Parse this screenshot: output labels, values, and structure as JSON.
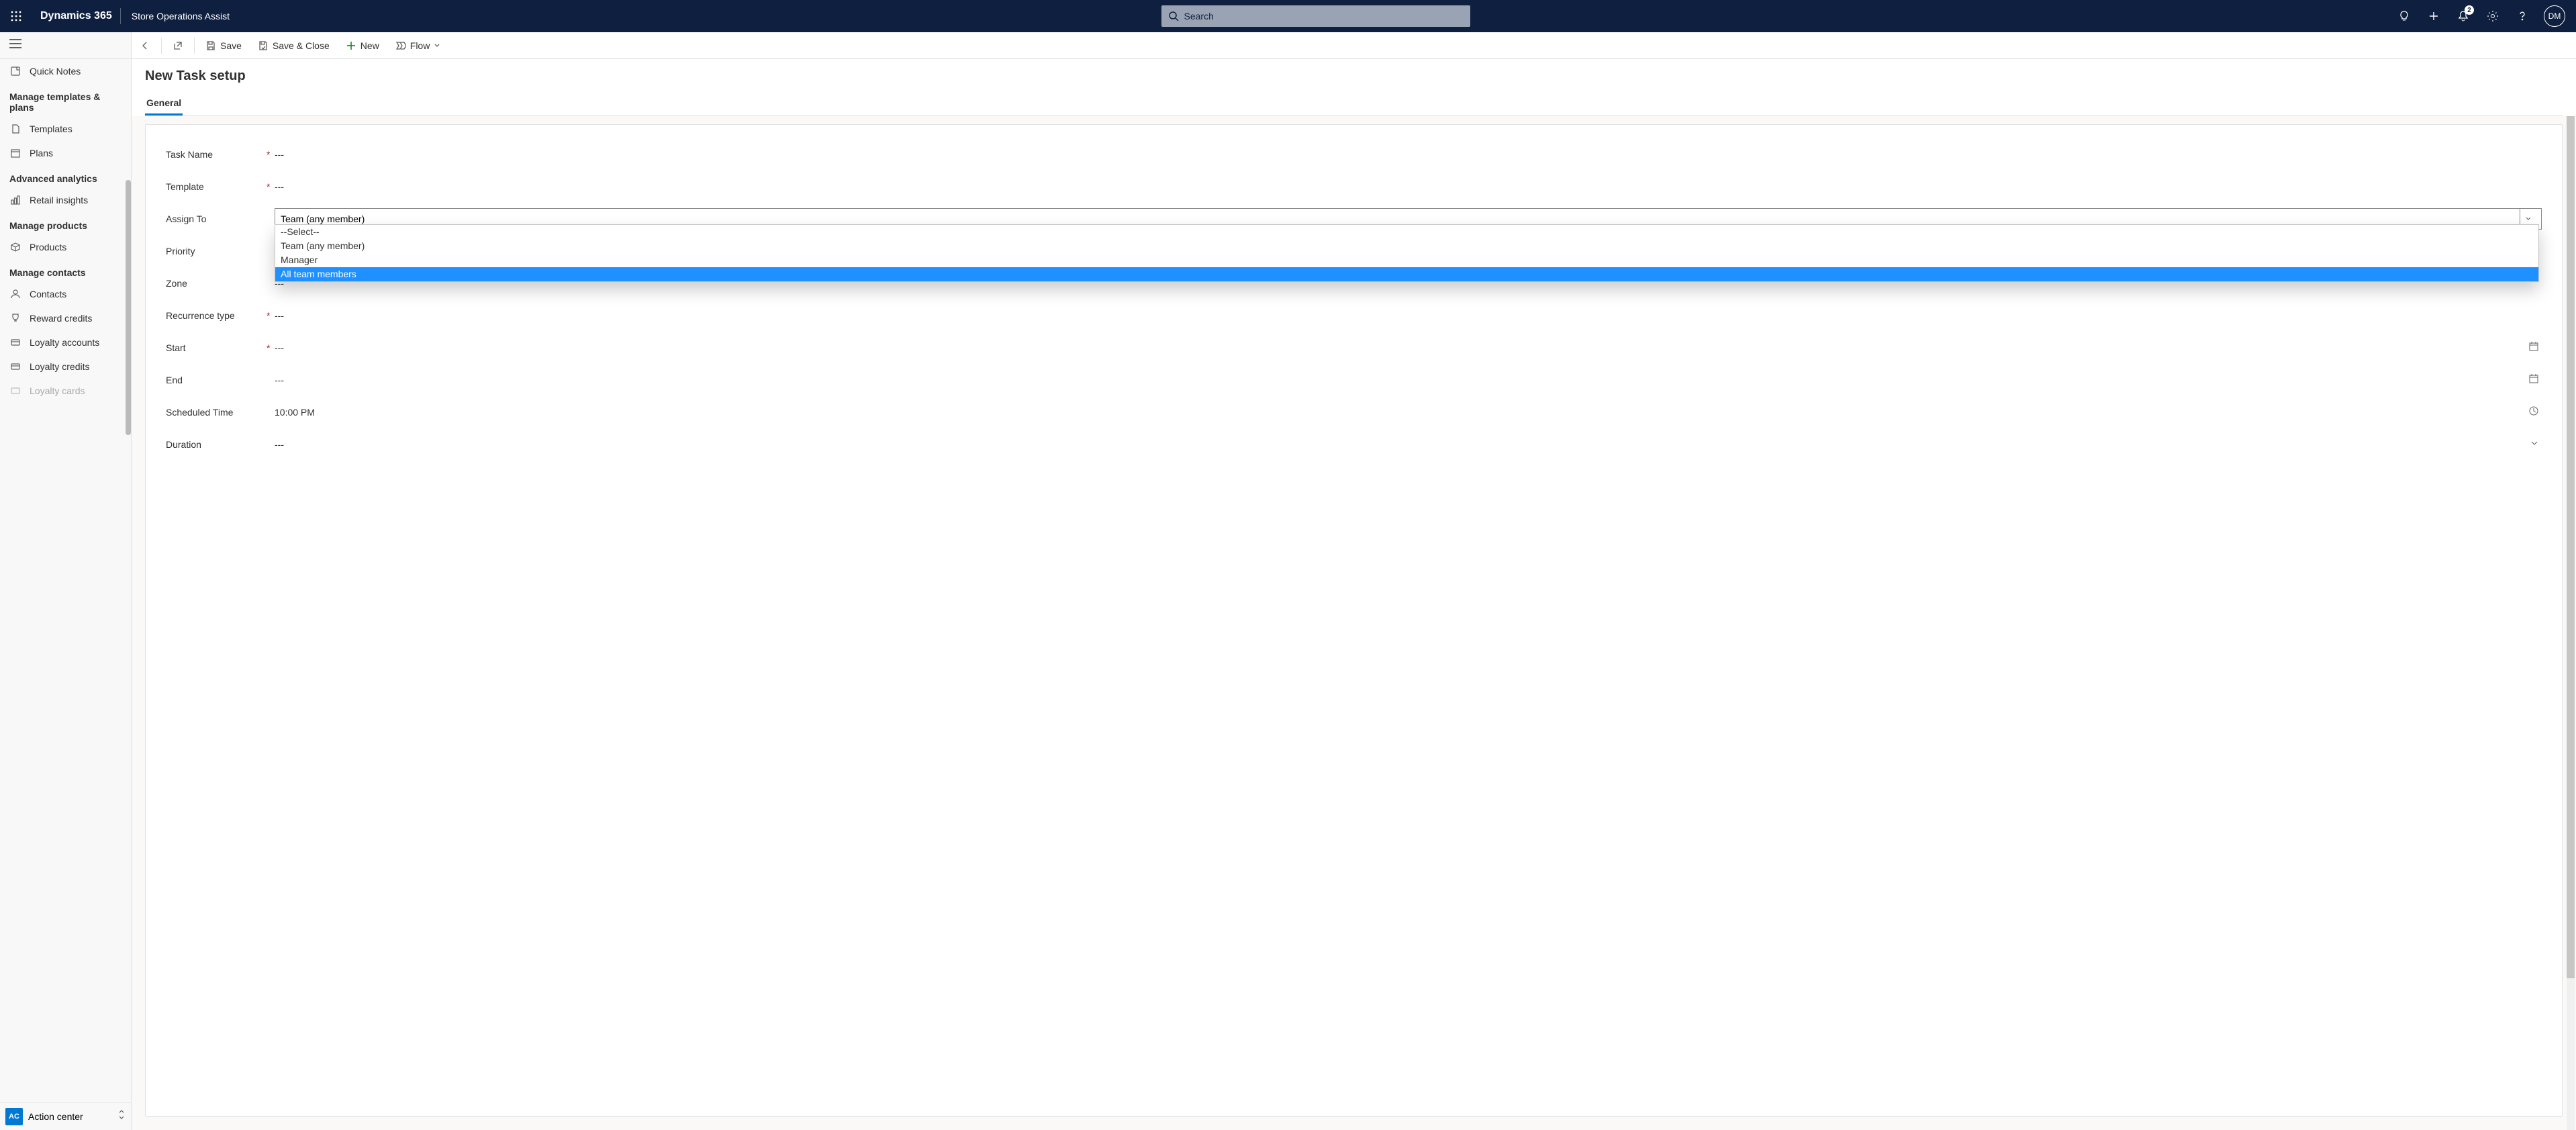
{
  "header": {
    "brand": "Dynamics 365",
    "app_name": "Store Operations Assist",
    "search_placeholder": "Search",
    "notification_count": "2",
    "avatar_initials": "DM"
  },
  "commands": {
    "save": "Save",
    "save_close": "Save & Close",
    "new": "New",
    "flow": "Flow"
  },
  "sidebar": {
    "quick_notes": "Quick Notes",
    "group_templates": "Manage templates & plans",
    "templates": "Templates",
    "plans": "Plans",
    "group_analytics": "Advanced analytics",
    "retail_insights": "Retail insights",
    "group_products": "Manage products",
    "products": "Products",
    "group_contacts": "Manage contacts",
    "contacts": "Contacts",
    "reward_credits": "Reward credits",
    "loyalty_accounts": "Loyalty accounts",
    "loyalty_credits": "Loyalty credits",
    "loyalty_cards": "Loyalty cards",
    "footer_badge": "AC",
    "footer_label": "Action center"
  },
  "page": {
    "title": "New Task setup",
    "tab_general": "General"
  },
  "form": {
    "task_name": {
      "label": "Task Name",
      "value": "---"
    },
    "template": {
      "label": "Template",
      "value": "---"
    },
    "assign_to": {
      "label": "Assign To",
      "selected": "Team (any member)",
      "options": {
        "select": "--Select--",
        "team_any": "Team (any member)",
        "manager": "Manager",
        "all_members": "All team members"
      }
    },
    "priority": {
      "label": "Priority"
    },
    "zone": {
      "label": "Zone",
      "value": "---"
    },
    "recurrence": {
      "label": "Recurrence type",
      "value": "---"
    },
    "start": {
      "label": "Start",
      "value": "---"
    },
    "end": {
      "label": "End",
      "value": "---"
    },
    "scheduled_time": {
      "label": "Scheduled Time",
      "value": "10:00 PM"
    },
    "duration": {
      "label": "Duration",
      "value": "---"
    }
  }
}
